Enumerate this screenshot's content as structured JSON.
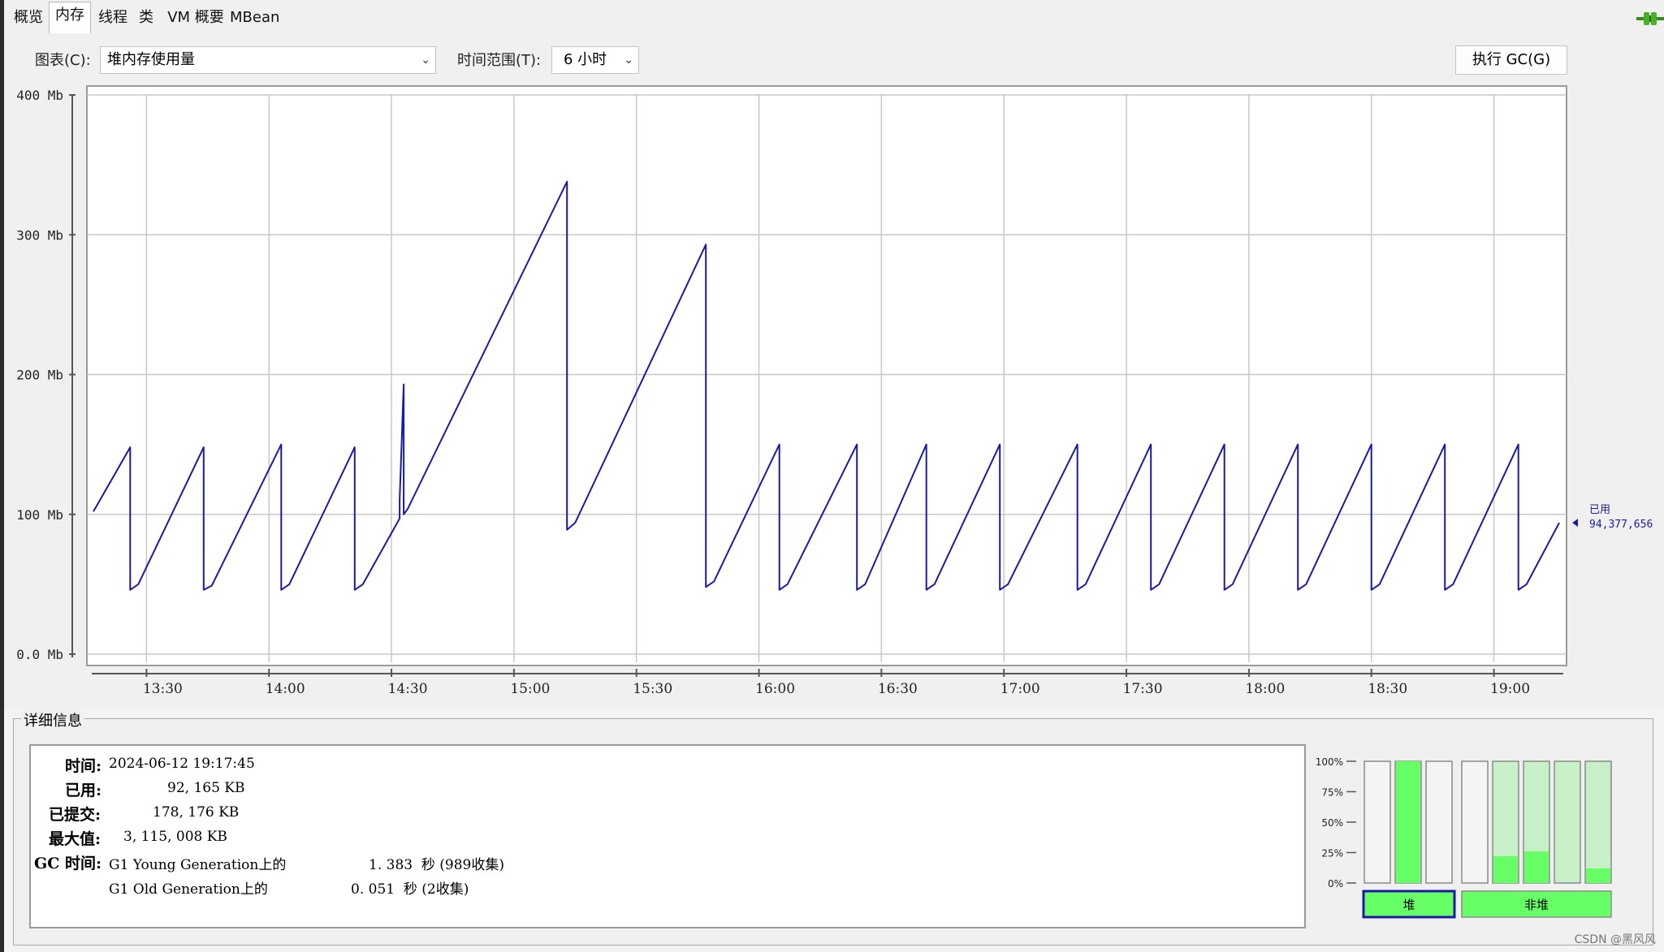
{
  "tabs": [
    "概览",
    "内存",
    "线程",
    "类",
    "VM 概要",
    "MBean"
  ],
  "active_tab": "内存",
  "toolbar": {
    "chart_label": "图表(C):",
    "chart_value": "堆内存使用量",
    "range_label": "时间范围(T):",
    "range_value": "6 小时",
    "gc_button": "执行 GC(G)"
  },
  "chart_data": {
    "type": "line",
    "y_ticks": [
      "0.0 Mb",
      "100 Mb",
      "200 Mb",
      "300 Mb",
      "400 Mb"
    ],
    "y_values": [
      0,
      100,
      200,
      300,
      400
    ],
    "x_ticks": [
      "13:30",
      "14:00",
      "14:30",
      "15:00",
      "15:30",
      "16:00",
      "16:30",
      "17:00",
      "17:30",
      "18:00",
      "18:30",
      "19:00"
    ],
    "x_minutes": [
      810,
      840,
      870,
      900,
      930,
      960,
      990,
      1020,
      1050,
      1080,
      1110,
      1140
    ],
    "xlim": [
      797,
      1157
    ],
    "ylim": [
      0,
      400
    ],
    "grid": true,
    "series": [
      {
        "color": "#1a1aa6",
        "points": [
          [
            797,
            102
          ],
          [
            806,
            148
          ],
          [
            806,
            46
          ],
          [
            808,
            50
          ],
          [
            824,
            148
          ],
          [
            824,
            46
          ],
          [
            826,
            49
          ],
          [
            843,
            150
          ],
          [
            843,
            46
          ],
          [
            845,
            50
          ],
          [
            861,
            148
          ],
          [
            861,
            46
          ],
          [
            863,
            50
          ],
          [
            872,
            97
          ],
          [
            872,
            110
          ],
          [
            873,
            193
          ],
          [
            873,
            100
          ],
          [
            874,
            104
          ],
          [
            913,
            338
          ],
          [
            913,
            89
          ],
          [
            915,
            94
          ],
          [
            947,
            293
          ],
          [
            947,
            48
          ],
          [
            949,
            52
          ],
          [
            965,
            150
          ],
          [
            965,
            46
          ],
          [
            967,
            50
          ],
          [
            984,
            150
          ],
          [
            984,
            46
          ],
          [
            986,
            50
          ],
          [
            1001,
            150
          ],
          [
            1001,
            46
          ],
          [
            1003,
            50
          ],
          [
            1019,
            150
          ],
          [
            1019,
            46
          ],
          [
            1021,
            50
          ],
          [
            1038,
            150
          ],
          [
            1038,
            46
          ],
          [
            1040,
            50
          ],
          [
            1056,
            150
          ],
          [
            1056,
            46
          ],
          [
            1058,
            50
          ],
          [
            1074,
            150
          ],
          [
            1074,
            46
          ],
          [
            1076,
            50
          ],
          [
            1092,
            150
          ],
          [
            1092,
            46
          ],
          [
            1094,
            50
          ],
          [
            1110,
            150
          ],
          [
            1110,
            46
          ],
          [
            1112,
            50
          ],
          [
            1128,
            150
          ],
          [
            1128,
            46
          ],
          [
            1130,
            50
          ],
          [
            1146,
            150
          ],
          [
            1146,
            46
          ],
          [
            1148,
            50
          ],
          [
            1156,
            94
          ]
        ]
      }
    ],
    "legend": {
      "label": "已用",
      "value": "94,377,656",
      "marker_value": 94
    }
  },
  "details": {
    "title": "详细信息",
    "time_label": "时间:",
    "time_value": "2024-06-12 19:17:45",
    "used_label": "已用:",
    "used_value": "92, 165 KB",
    "committed_label": "已提交:",
    "committed_value": "178, 176 KB",
    "max_label": "最大值:",
    "max_value": "3, 115, 008 KB",
    "gc_label": "GC 时间:",
    "gc_young_name": "G1 Young Generation上的",
    "gc_young_value": "1. 383  秒 (989收集)",
    "gc_old_name": "G1 Old Generation上的",
    "gc_old_value": "0. 051  秒 (2收集)"
  },
  "pool_bars": {
    "ticks": [
      "100%",
      "75%",
      "50%",
      "25%",
      "0%"
    ],
    "heap": {
      "label": "堆",
      "fills": [
        0.0,
        1.0,
        0.0
      ],
      "committed": [
        false,
        true,
        false
      ]
    },
    "nonheap": {
      "label": "非堆",
      "fills": [
        0.0,
        0.22,
        0.26,
        0.0,
        0.12
      ],
      "committed": [
        false,
        true,
        true,
        true,
        true
      ]
    },
    "colors": {
      "committed_bg": "#c8f0c8",
      "used": "#66ff66",
      "border": "#8a8a8a",
      "heap_selected_border": "#1a1aa6"
    }
  },
  "watermark": "CSDN @黑风风"
}
